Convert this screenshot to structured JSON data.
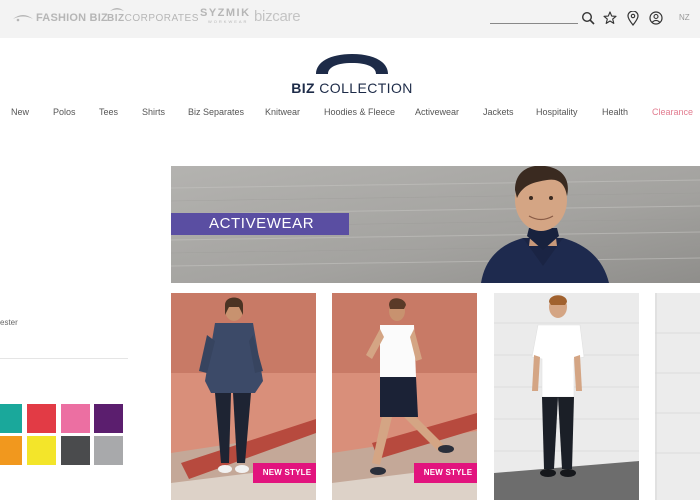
{
  "top_bar": {
    "brands": [
      {
        "name": "FASHION BIZ",
        "icon": "fashion-biz-swoosh-icon"
      },
      {
        "name_bold": "BIZ",
        "name_regular": "CORPORATES",
        "icon": "biz-swoosh-icon"
      },
      {
        "name": "SYZMIK",
        "tagline": "WORKWEAR"
      },
      {
        "name": "bizcare"
      }
    ],
    "icons": [
      "search-icon",
      "star-icon",
      "location-pin-icon",
      "user-icon"
    ],
    "region": "NZ"
  },
  "logo": {
    "text_bold": "BIZ",
    "text_regular": "COLLECTION",
    "color": "#1d2b48"
  },
  "nav": {
    "items": [
      {
        "label": "New"
      },
      {
        "label": "Polos"
      },
      {
        "label": "Tees"
      },
      {
        "label": "Shirts"
      },
      {
        "label": "Biz Separates"
      },
      {
        "label": "Knitwear"
      },
      {
        "label": "Hoodies & Fleece"
      },
      {
        "label": "Activewear"
      },
      {
        "label": "Jackets"
      },
      {
        "label": "Hospitality"
      },
      {
        "label": "Health"
      },
      {
        "label": "Clearance"
      }
    ]
  },
  "sidebar": {
    "filter_text": "ester",
    "swatches": [
      "#1aa89b",
      "#e23b45",
      "#ec6fa2",
      "#5b1e6e",
      "#f1981e",
      "#f3e52a",
      "#4a4b4d",
      "#a8a9ab"
    ]
  },
  "banner": {
    "title": "ACTIVEWEAR",
    "label_color": "#5a4ea2"
  },
  "products": [
    {
      "badge": "NEW STYLE"
    },
    {
      "badge": "NEW STYLE"
    },
    {
      "badge": ""
    },
    {
      "badge": ""
    }
  ],
  "colors": {
    "badge": "#e2147e",
    "sale": "#e27b8f",
    "top_bar": "#f3f3f3"
  }
}
